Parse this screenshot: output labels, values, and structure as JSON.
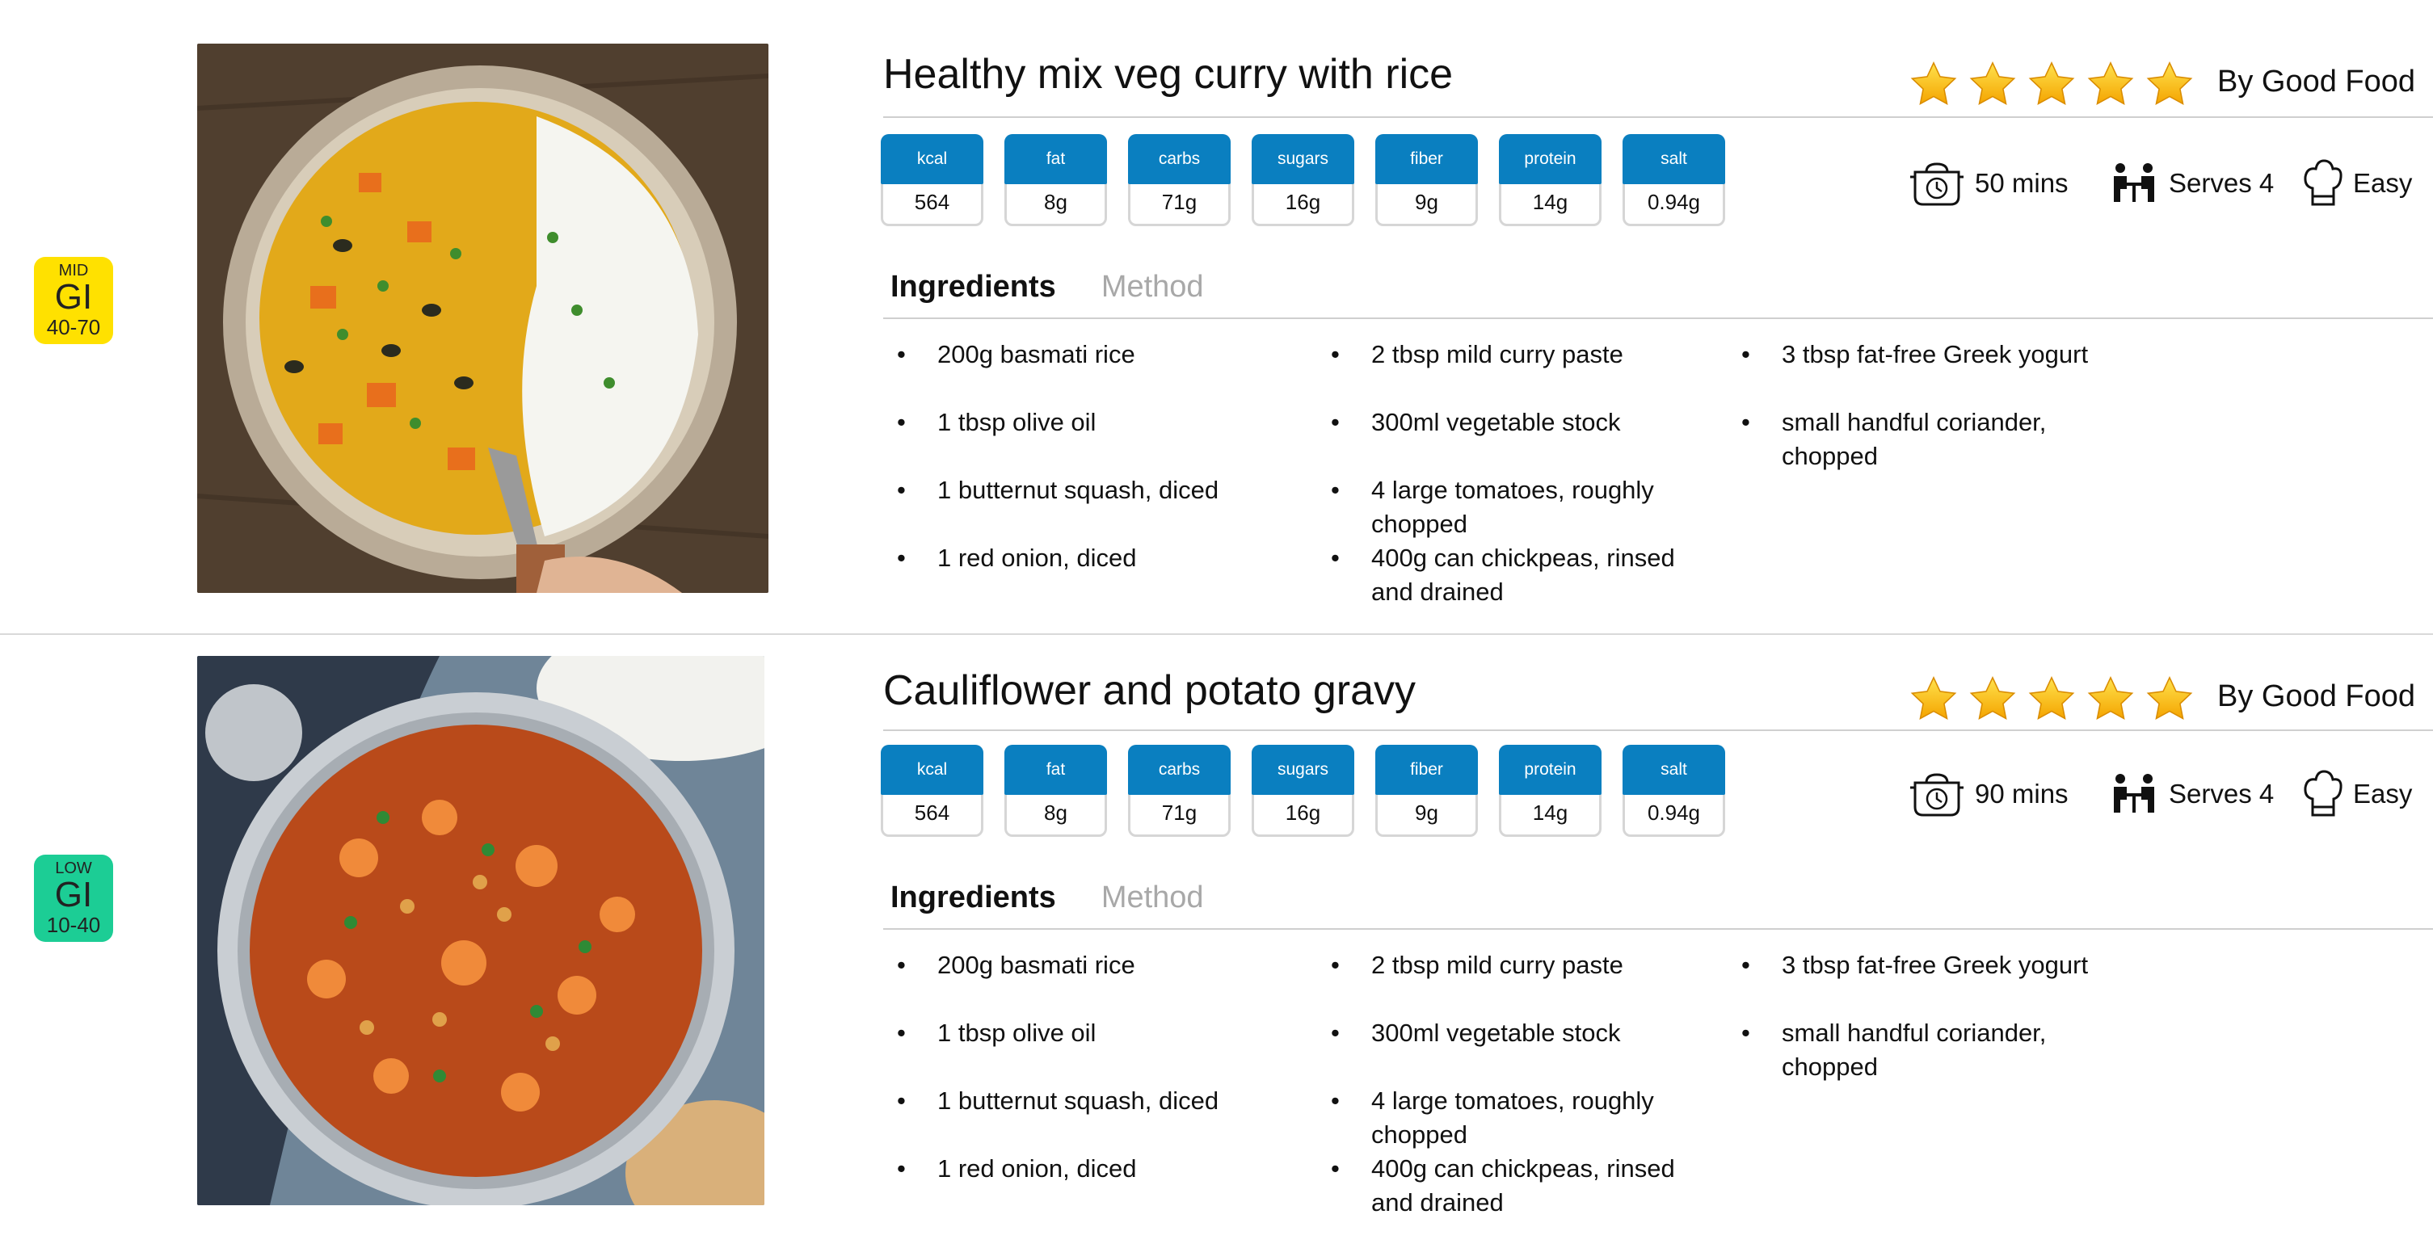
{
  "recipes": [
    {
      "gi": {
        "level": "MID",
        "label": "GI",
        "range": "40-70",
        "color": "#ffe100"
      },
      "image": "vegetable curry with white rice in bowl",
      "title": "Healthy mix veg curry with rice",
      "rating": 5,
      "byline": "By Good Food",
      "nutrition": [
        {
          "label": "kcal",
          "value": "564"
        },
        {
          "label": "fat",
          "value": "8g"
        },
        {
          "label": "carbs",
          "value": "71g"
        },
        {
          "label": "sugars",
          "value": "16g"
        },
        {
          "label": "fiber",
          "value": "9g"
        },
        {
          "label": "protein",
          "value": "14g"
        },
        {
          "label": "salt",
          "value": "0.94g"
        }
      ],
      "time": "50 mins",
      "serves": "Serves 4",
      "difficulty": "Easy",
      "tabs": {
        "active": "Ingredients",
        "inactive": "Method"
      },
      "ingredients": [
        [
          "200g basmati rice",
          "1 tbsp olive oil",
          "1 butternut squash, diced",
          "1 red onion, diced"
        ],
        [
          "2 tbsp mild curry paste",
          "300ml vegetable stock",
          "4 large tomatoes, roughly chopped",
          "400g can chickpeas, rinsed and drained"
        ],
        [
          "3 tbsp fat-free Greek yogurt",
          "small handful coriander, chopped"
        ]
      ]
    },
    {
      "gi": {
        "level": "LOW",
        "label": "GI",
        "range": "10-40",
        "color": "#1ccd95"
      },
      "image": "cauliflower and chickpea curry in pan",
      "title": "Cauliflower and potato gravy",
      "rating": 5,
      "byline": "By Good Food",
      "nutrition": [
        {
          "label": "kcal",
          "value": "564"
        },
        {
          "label": "fat",
          "value": "8g"
        },
        {
          "label": "carbs",
          "value": "71g"
        },
        {
          "label": "sugars",
          "value": "16g"
        },
        {
          "label": "fiber",
          "value": "9g"
        },
        {
          "label": "protein",
          "value": "14g"
        },
        {
          "label": "salt",
          "value": "0.94g"
        }
      ],
      "time": "90 mins",
      "serves": "Serves 4",
      "difficulty": "Easy",
      "tabs": {
        "active": "Ingredients",
        "inactive": "Method"
      },
      "ingredients": [
        [
          "200g basmati rice",
          "1 tbsp olive oil",
          "1 butternut squash, diced",
          "1 red onion, diced"
        ],
        [
          "2 tbsp mild curry paste",
          "300ml vegetable stock",
          "4 large tomatoes, roughly chopped",
          "400g can chickpeas, rinsed and drained"
        ],
        [
          "3 tbsp fat-free Greek yogurt",
          "small handful coriander, chopped"
        ]
      ]
    }
  ]
}
